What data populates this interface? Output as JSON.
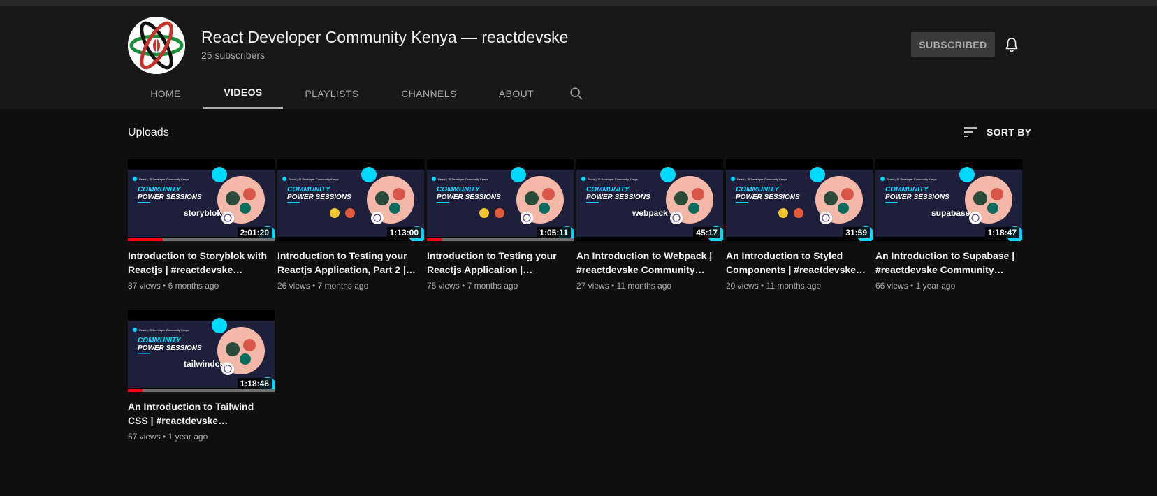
{
  "channel": {
    "title": "React Developer Community Kenya — reactdevske",
    "subscribers": "25 subscribers",
    "subscribed_label": "SUBSCRIBED"
  },
  "tabs": [
    {
      "label": "HOME",
      "active": false
    },
    {
      "label": "VIDEOS",
      "active": true
    },
    {
      "label": "PLAYLISTS",
      "active": false
    },
    {
      "label": "CHANNELS",
      "active": false
    },
    {
      "label": "ABOUT",
      "active": false
    }
  ],
  "section": {
    "title": "Uploads",
    "sort_label": "SORT BY"
  },
  "thumbnail_text": {
    "brand": "React | JS Developer Community Kenya",
    "line1": "COMMUNITY",
    "line2": "POWER SESSIONS"
  },
  "videos": [
    {
      "title": "Introduction to Storyblok with Reactjs | #reactdevske…",
      "views": "87 views",
      "age": "6 months ago",
      "duration": "2:01:20",
      "logo": "storyblok",
      "watched": 0.24
    },
    {
      "title": "Introduction to Testing your Reactjs Application, Part 2 |…",
      "views": "26 views",
      "age": "7 months ago",
      "duration": "1:13:00",
      "logo": "",
      "watched": 0
    },
    {
      "title": "Introduction to Testing your Reactjs Application |…",
      "views": "75 views",
      "age": "7 months ago",
      "duration": "1:05:11",
      "logo": "",
      "watched": 0.1
    },
    {
      "title": "An Introduction to Webpack | #reactdevske Community…",
      "views": "27 views",
      "age": "11 months ago",
      "duration": "45:17",
      "logo": "webpack",
      "watched": 0
    },
    {
      "title": "An Introduction to Styled Components | #reactdevske…",
      "views": "20 views",
      "age": "11 months ago",
      "duration": "31:59",
      "logo": "",
      "watched": 0
    },
    {
      "title": "An Introduction to Supabase | #reactdevske Community…",
      "views": "66 views",
      "age": "1 year ago",
      "duration": "1:18:47",
      "logo": "supabase",
      "watched": 0
    },
    {
      "title": "An Introduction to Tailwind CSS | #reactdevske…",
      "views": "57 views",
      "age": "1 year ago",
      "duration": "1:18:46",
      "logo": "tailwindcss",
      "watched": 0.1
    }
  ],
  "colors": {
    "background": "#0f0f0f",
    "header": "#181818",
    "progress_red": "#ff0000",
    "thumb_accent": "#00d8ff"
  }
}
